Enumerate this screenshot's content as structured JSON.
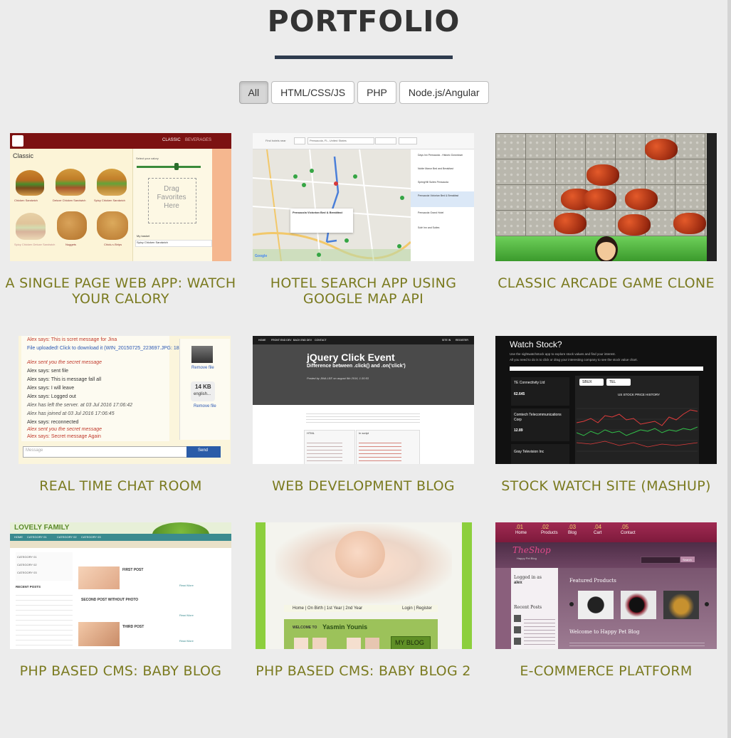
{
  "section": {
    "title": "PORTFOLIO"
  },
  "filters": [
    {
      "label": "All",
      "active": true
    },
    {
      "label": "HTML/CSS/JS",
      "active": false
    },
    {
      "label": "PHP",
      "active": false
    },
    {
      "label": "Node.js/Angular",
      "active": false
    }
  ],
  "items": [
    {
      "caption": "A SINGLE PAGE WEB APP: WATCH YOUR CALORY",
      "thumb": {
        "tab_classic": "CLASSIC",
        "tab_beverages": "BEVERAGES",
        "heading": "Classic",
        "slider_label": "Select your calory",
        "drag_text": "Drag Favorites Here",
        "basket_label": "My basket",
        "basket_item": "Spicy Chicken Sandwich",
        "products": [
          "Chicken Sandwich",
          "Deluxe Chicken Sandwich",
          "Spicy Chicken Sandwich",
          "Spicy Chicken Deluxe Sandwich",
          "Nuggets",
          "Chick-n-Strips"
        ]
      }
    },
    {
      "caption": "HOTEL SEARCH APP USING GOOGLE MAP API",
      "thumb": {
        "label_find": "Find hotels near",
        "location": "Pensacola, FL, United States",
        "popup_title": "Pensacola Victorian Bed & Breakfast",
        "list": [
          "Days Inn Pensacola - Historic Downtown",
          "Noble Manor Bed and Breakfast",
          "SpringHill Suites Pensacola",
          "Pensacola Victorian Bed & Breakfast",
          "Pensacola Grand Hotel",
          "Solé Inn and Suites"
        ],
        "google": "Google"
      }
    },
    {
      "caption": "CLASSIC ARCADE GAME CLONE",
      "thumb": {}
    },
    {
      "caption": "REAL TIME CHAT ROOM",
      "thumb": {
        "lines": [
          "Alex says: This is scret message for Jina",
          "File uploaded! Click to download it (WIN_20150725_223697.JPG: 183.541KB)",
          "Alex sent you the secret message",
          "Alex says: sent file",
          "Alex says: This is message fall all",
          "Alex says: I will leave",
          "Alex says: Logged out",
          "Alex has left the server. at 03 Jul 2016 17:06:42",
          "Alex has joined at 03 Jul 2016 17:06:45",
          "Alex says: reconnected",
          "Alex sent you the secret message",
          "Alex says: Secret message Again"
        ],
        "remove": "Remove file",
        "size": "14 KB",
        "filename": "english...",
        "input_placeholder": "Message",
        "send": "Send"
      }
    },
    {
      "caption": "WEB DEVELOPMENT BLOG",
      "thumb": {
        "nav": [
          "HOME",
          "FRONT END DEV",
          "BACK END DEV",
          "CONTACT"
        ],
        "nav_right": [
          "SITE IN",
          "REGISTER"
        ],
        "post_title": "jQuery Click Event",
        "post_subtitle": "Difference between .click() and .on('click')",
        "meta": "Posted by JINA LEE on august 9th 2016, 1:30:53",
        "col1": "HTML",
        "col2": "In script"
      }
    },
    {
      "caption": "STOCK WATCH SITE (MASHUP)",
      "thumb": {
        "title": "Watch Stock?",
        "desc1": "Use the sightwatchstock app to explore stock values and find your interest.",
        "desc2": "All you need to do is to click or drag your interesting company to see the stock value chart.",
        "companies": [
          {
            "name": "TE Connectivity Ltd",
            "price": "62.645"
          },
          {
            "name": "Comtech Telecommunications Corp",
            "price": "12.89"
          },
          {
            "name": "Gray Television Inc",
            "price": ""
          }
        ],
        "tags": [
          "SBUX",
          "TEL"
        ],
        "chart_title": "US STOCK PRICE HISTORY"
      }
    },
    {
      "caption": "PHP BASED CMS: BABY BLOG",
      "thumb": {
        "brand": "LOVELY FAMILY",
        "nav": [
          "HOME",
          "CATEGORY 01",
          "CATEGORY 02",
          "CATEGORY 03"
        ],
        "cats": [
          "CATEGORY 01",
          "CATEGORY 02",
          "CATEGORY 03"
        ],
        "recent": "RECENT POSTS",
        "posts": [
          "FIRST POST",
          "SECOND POST WITHOUT PHOTO",
          "THIRD POST"
        ],
        "read_more": "Read More"
      }
    },
    {
      "caption": "PHP BASED CMS: BABY BLOG 2",
      "thumb": {
        "nav": "Home | On Birth | 1st Year | 2nd Year",
        "login": "Login | Register",
        "welcome_prefix": "WELCOME TO",
        "welcome_name": "Yasmin Younis",
        "blog_btn": "MY BLOG"
      }
    },
    {
      "caption": "E-COMMERCE PLATFORM",
      "thumb": {
        "nav": [
          {
            "num": ".01",
            "label": "Home"
          },
          {
            "num": ".02",
            "label": "Products"
          },
          {
            "num": ".03",
            "label": "Blog"
          },
          {
            "num": ".04",
            "label": "Cart"
          },
          {
            "num": ".05",
            "label": "Contact"
          }
        ],
        "logo": "TheShop",
        "tagline": "Happy Pet Blog",
        "search_btn": "Search",
        "logged": "Logged in as",
        "user": "alex",
        "recent": "Recent Posts",
        "featured": "Featured Products",
        "welcome": "Welcome to Happy Pet Blog"
      }
    }
  ]
}
